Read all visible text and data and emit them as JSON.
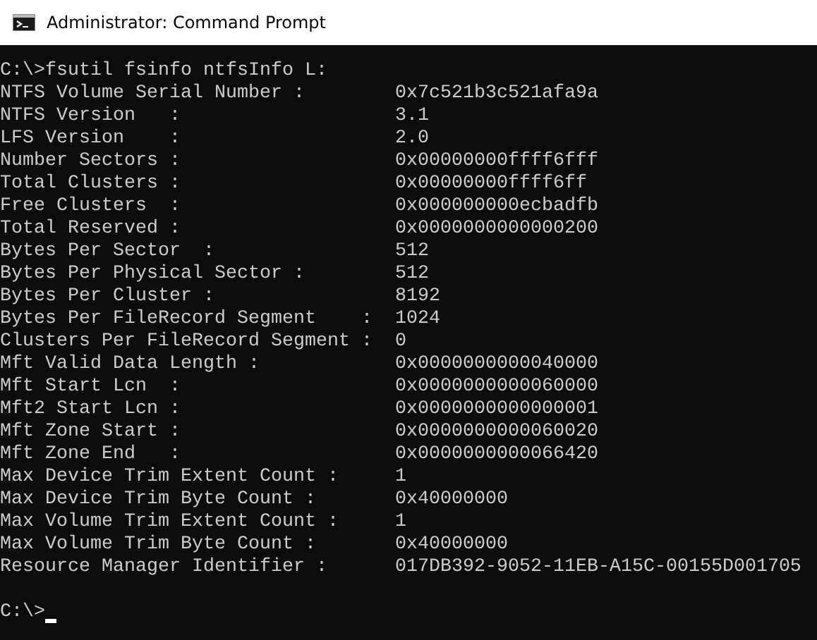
{
  "window": {
    "title": "Administrator: Command Prompt"
  },
  "command": {
    "prompt": "C:\\>",
    "text": "fsutil fsinfo ntfsInfo L:"
  },
  "output": [
    {
      "label": "NTFS Volume Serial Number :",
      "value": "0x7c521b3c521afa9a"
    },
    {
      "label": "NTFS Version   :",
      "value": "3.1"
    },
    {
      "label": "LFS Version    :",
      "value": "2.0"
    },
    {
      "label": "Number Sectors :",
      "value": "0x00000000ffff6fff"
    },
    {
      "label": "Total Clusters :",
      "value": "0x00000000ffff6ff"
    },
    {
      "label": "Free Clusters  :",
      "value": "0x000000000ecbadfb"
    },
    {
      "label": "Total Reserved :",
      "value": "0x0000000000000200"
    },
    {
      "label": "Bytes Per Sector  :",
      "value": "512"
    },
    {
      "label": "Bytes Per Physical Sector :",
      "value": "512"
    },
    {
      "label": "Bytes Per Cluster :",
      "value": "8192"
    },
    {
      "label": "Bytes Per FileRecord Segment    :",
      "value": "1024"
    },
    {
      "label": "Clusters Per FileRecord Segment :",
      "value": "0"
    },
    {
      "label": "Mft Valid Data Length :",
      "value": "0x0000000000040000"
    },
    {
      "label": "Mft Start Lcn  :",
      "value": "0x0000000000060000"
    },
    {
      "label": "Mft2 Start Lcn :",
      "value": "0x0000000000000001"
    },
    {
      "label": "Mft Zone Start :",
      "value": "0x0000000000060020"
    },
    {
      "label": "Mft Zone End   :",
      "value": "0x0000000000066420"
    },
    {
      "label": "Max Device Trim Extent Count :",
      "value": "1"
    },
    {
      "label": "Max Device Trim Byte Count :",
      "value": "0x40000000"
    },
    {
      "label": "Max Volume Trim Extent Count :",
      "value": "1"
    },
    {
      "label": "Max Volume Trim Byte Count :",
      "value": "0x40000000"
    },
    {
      "label": "Resource Manager Identifier :",
      "value": "017DB392-9052-11EB-A15C-00155D001705"
    }
  ],
  "final_prompt": "C:\\>"
}
